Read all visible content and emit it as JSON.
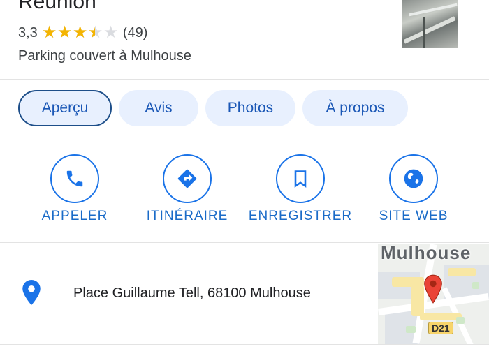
{
  "place": {
    "title": "Réunion",
    "rating": "3,3",
    "rating_value": 3.3,
    "rating_max": 5,
    "review_count": "(49)",
    "category": "Parking couvert à Mulhouse"
  },
  "tabs": [
    {
      "label": "Aperçu",
      "active": true
    },
    {
      "label": "Avis",
      "active": false
    },
    {
      "label": "Photos",
      "active": false
    },
    {
      "label": "À propos",
      "active": false
    }
  ],
  "actions": [
    {
      "label": "APPELER",
      "icon": "phone-icon"
    },
    {
      "label": "ITINÉRAIRE",
      "icon": "directions-icon"
    },
    {
      "label": "ENREGISTRER",
      "icon": "bookmark-icon"
    },
    {
      "label": "SITE WEB",
      "icon": "globe-icon"
    }
  ],
  "address": {
    "text": "Place Guillaume Tell, 68100 Mulhouse",
    "icon": "location-pin-icon"
  },
  "map": {
    "city_label": "Mulhouse",
    "road_label": "D21"
  },
  "colors": {
    "accent": "#1a73e8",
    "tab_bg": "#e8f0fe",
    "star": "#f4b400",
    "map_pin": "#ea4335"
  }
}
